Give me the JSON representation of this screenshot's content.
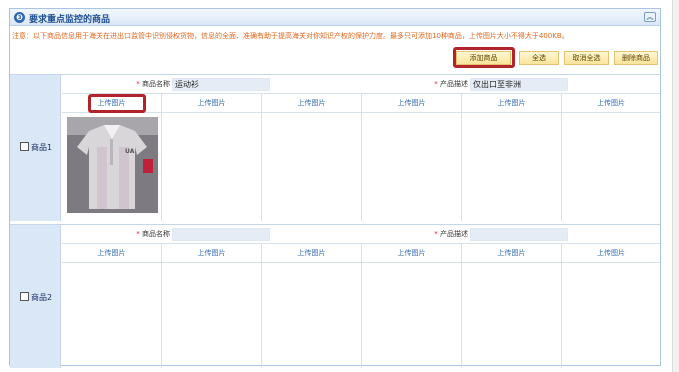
{
  "panel": {
    "icon": "❸",
    "title": "要求重点监控的商品",
    "collapse_icon": "︽"
  },
  "notice": "注意：以下商品信息用于海关在进出口监管中识别侵权货物，信息的全面、准确有助于提高海关对你知识产权的保护力度。最多只可添加10种商品，上传图片大小不得大于400KB。",
  "actions": {
    "add": "添加商品",
    "select_all": "全选",
    "deselect_all": "取消全选",
    "delete": "删除商品"
  },
  "products": [
    {
      "label": "商品1",
      "name_label": "商品名称",
      "name_value": "运动衫",
      "desc_label": "产品描述",
      "desc_value": "仅出口至非洲",
      "uploads": [
        "上传图片",
        "上传图片",
        "上传图片",
        "上传图片",
        "上传图片",
        "上传图片"
      ]
    },
    {
      "label": "商品2",
      "name_label": "商品名称",
      "name_value": "",
      "desc_label": "产品描述",
      "desc_value": "",
      "uploads": [
        "上传图片",
        "上传图片",
        "上传图片",
        "上传图片",
        "上传图片",
        "上传图片"
      ]
    }
  ],
  "photo": {
    "brand_mark": "UA"
  },
  "colors": {
    "accent": "#2d66b3",
    "highlight": "#b3232c",
    "notice": "#e0671e",
    "side": "#d9e7f7"
  }
}
